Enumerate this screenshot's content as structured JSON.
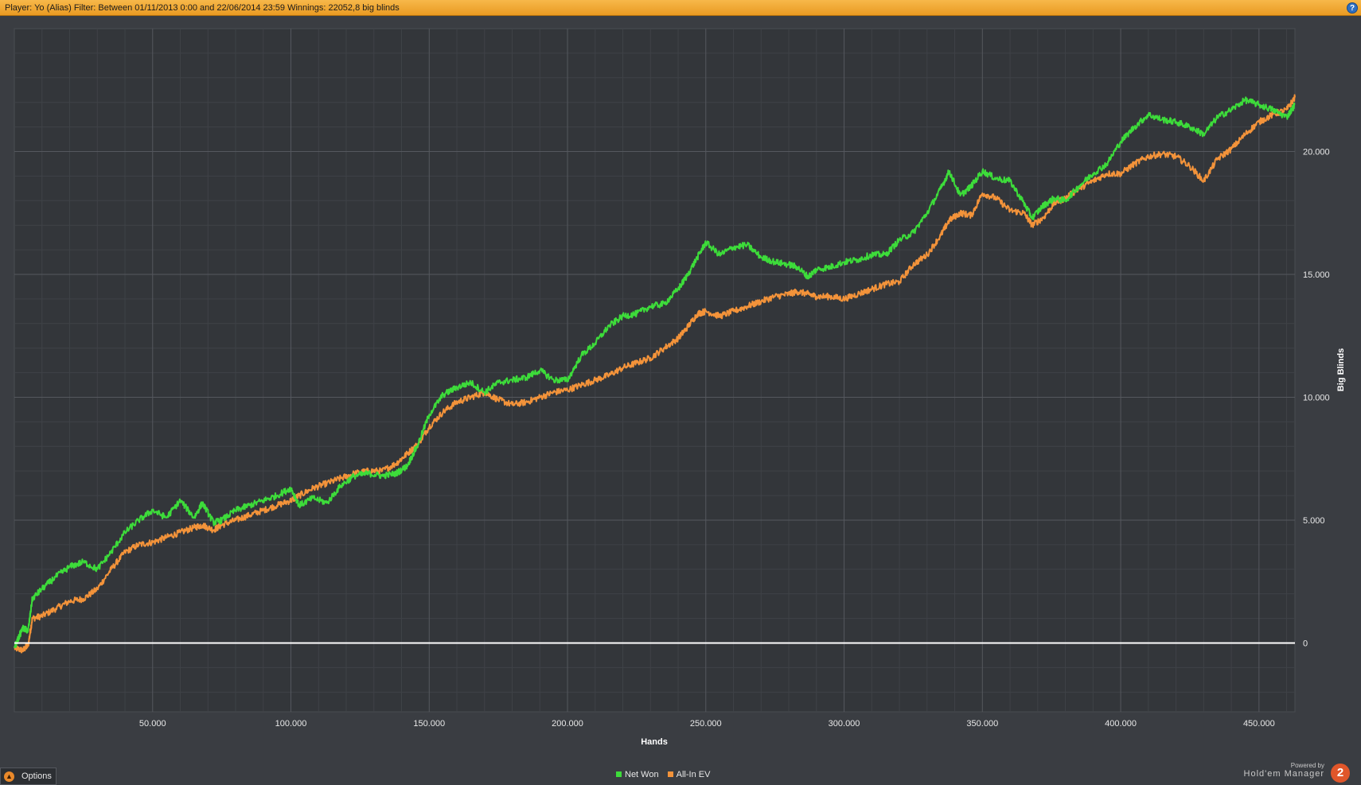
{
  "title_bar": {
    "text": "Player: Yo (Alias) Filter: Between 01/11/2013 0:00 and 22/06/2014 23:59 Winnings: 22052,8 big blinds",
    "help_icon": "question-icon"
  },
  "options": {
    "label": "Options",
    "icon": "chevron-up-icon"
  },
  "powered": {
    "line1": "Powered by",
    "line2": "Hold'em Manager",
    "logo_text": "2"
  },
  "colors": {
    "net_won": "#3ddc3a",
    "all_in_ev": "#f3933a",
    "background": "#3a3d42",
    "plot": "#33363a",
    "zero_line": "#ffffff"
  },
  "chart_data": {
    "type": "line",
    "xlabel": "Hands",
    "ylabel": "Big Blinds",
    "xlim": [
      0,
      463000
    ],
    "ylim": [
      -2800,
      25000
    ],
    "xticks": [
      50000,
      100000,
      150000,
      200000,
      250000,
      300000,
      350000,
      400000,
      450000
    ],
    "xtick_labels": [
      "50.000",
      "100.000",
      "150.000",
      "200.000",
      "250.000",
      "300.000",
      "350.000",
      "400.000",
      "450.000"
    ],
    "yticks": [
      0,
      5000,
      10000,
      15000,
      20000
    ],
    "ytick_labels": [
      "0",
      "5.000",
      "10.000",
      "15.000",
      "20.000"
    ],
    "grid": true,
    "legend_position": "bottom-center",
    "series": [
      {
        "name": "Net Won",
        "color": "#3ddc3a",
        "x": [
          0,
          3000,
          5000,
          6500,
          10000,
          15000,
          20000,
          25000,
          30000,
          35000,
          40000,
          45000,
          50000,
          55000,
          60000,
          65000,
          68000,
          72000,
          75000,
          80000,
          85000,
          90000,
          95000,
          100000,
          103000,
          108000,
          113000,
          118000,
          123000,
          128000,
          133000,
          138000,
          142000,
          146000,
          150000,
          155000,
          160000,
          165000,
          170000,
          175000,
          180000,
          185000,
          190000,
          195000,
          200000,
          205000,
          210000,
          215000,
          220000,
          225000,
          230000,
          235000,
          240000,
          243000,
          247000,
          250000,
          255000,
          260000,
          265000,
          270000,
          275000,
          280000,
          283000,
          287000,
          290000,
          295000,
          300000,
          305000,
          310000,
          315000,
          320000,
          325000,
          330000,
          335000,
          338000,
          342000,
          346000,
          350000,
          355000,
          360000,
          365000,
          368000,
          372000,
          376000,
          380000,
          385000,
          390000,
          395000,
          400000,
          405000,
          410000,
          415000,
          420000,
          425000,
          430000,
          435000,
          440000,
          445000,
          450000,
          455000,
          460000,
          463000
        ],
        "y": [
          -200,
          600,
          500,
          1800,
          2200,
          2700,
          3100,
          3300,
          3000,
          3700,
          4500,
          5000,
          5400,
          5100,
          5800,
          5100,
          5700,
          4900,
          5000,
          5400,
          5600,
          5800,
          6000,
          6300,
          5600,
          5900,
          5700,
          6400,
          6800,
          6900,
          6800,
          6900,
          7200,
          8100,
          9300,
          10100,
          10400,
          10600,
          10200,
          10600,
          10700,
          10800,
          11100,
          10700,
          10700,
          11700,
          12200,
          12900,
          13300,
          13400,
          13700,
          13800,
          14400,
          14900,
          15700,
          16300,
          15800,
          16100,
          16200,
          15700,
          15500,
          15400,
          15300,
          14900,
          15200,
          15300,
          15500,
          15600,
          15800,
          15800,
          16400,
          16700,
          17500,
          18500,
          19200,
          18200,
          18600,
          19200,
          18900,
          18800,
          17900,
          17300,
          17800,
          18100,
          18000,
          18600,
          19100,
          19500,
          20400,
          21000,
          21500,
          21300,
          21200,
          21000,
          20700,
          21400,
          21700,
          22100,
          21900,
          21700,
          21400,
          21900
        ]
      },
      {
        "name": "All-In EV",
        "color": "#f3933a",
        "x": [
          0,
          3000,
          5000,
          6500,
          10000,
          15000,
          20000,
          25000,
          30000,
          35000,
          40000,
          45000,
          50000,
          55000,
          60000,
          65000,
          68000,
          72000,
          75000,
          80000,
          85000,
          90000,
          95000,
          100000,
          103000,
          108000,
          113000,
          118000,
          123000,
          128000,
          133000,
          138000,
          142000,
          146000,
          150000,
          155000,
          160000,
          165000,
          170000,
          175000,
          180000,
          185000,
          190000,
          195000,
          200000,
          205000,
          210000,
          215000,
          220000,
          225000,
          230000,
          235000,
          240000,
          243000,
          247000,
          250000,
          255000,
          260000,
          265000,
          270000,
          275000,
          280000,
          283000,
          287000,
          290000,
          295000,
          300000,
          305000,
          310000,
          315000,
          320000,
          325000,
          330000,
          335000,
          338000,
          342000,
          346000,
          350000,
          355000,
          360000,
          365000,
          368000,
          372000,
          376000,
          380000,
          385000,
          390000,
          395000,
          400000,
          405000,
          410000,
          415000,
          420000,
          425000,
          430000,
          435000,
          440000,
          445000,
          450000,
          455000,
          460000,
          463000
        ],
        "y": [
          -200,
          -300,
          -100,
          1000,
          1100,
          1400,
          1700,
          1800,
          2200,
          3000,
          3700,
          4000,
          4100,
          4300,
          4500,
          4700,
          4800,
          4600,
          4800,
          5000,
          5200,
          5400,
          5600,
          5800,
          6000,
          6300,
          6500,
          6700,
          6900,
          7000,
          7000,
          7300,
          7700,
          8100,
          8800,
          9400,
          9800,
          10000,
          10200,
          9900,
          9700,
          9800,
          10000,
          10200,
          10300,
          10500,
          10700,
          10900,
          11200,
          11400,
          11600,
          12000,
          12400,
          12800,
          13400,
          13500,
          13300,
          13500,
          13700,
          13900,
          14100,
          14200,
          14300,
          14200,
          14100,
          14100,
          14000,
          14200,
          14400,
          14600,
          14700,
          15400,
          15800,
          16600,
          17200,
          17500,
          17400,
          18300,
          18100,
          17600,
          17500,
          17000,
          17300,
          17900,
          18100,
          18500,
          18800,
          19100,
          19100,
          19500,
          19800,
          19900,
          19800,
          19400,
          18800,
          19700,
          20100,
          20700,
          21200,
          21500,
          21700,
          22200
        ]
      }
    ]
  }
}
